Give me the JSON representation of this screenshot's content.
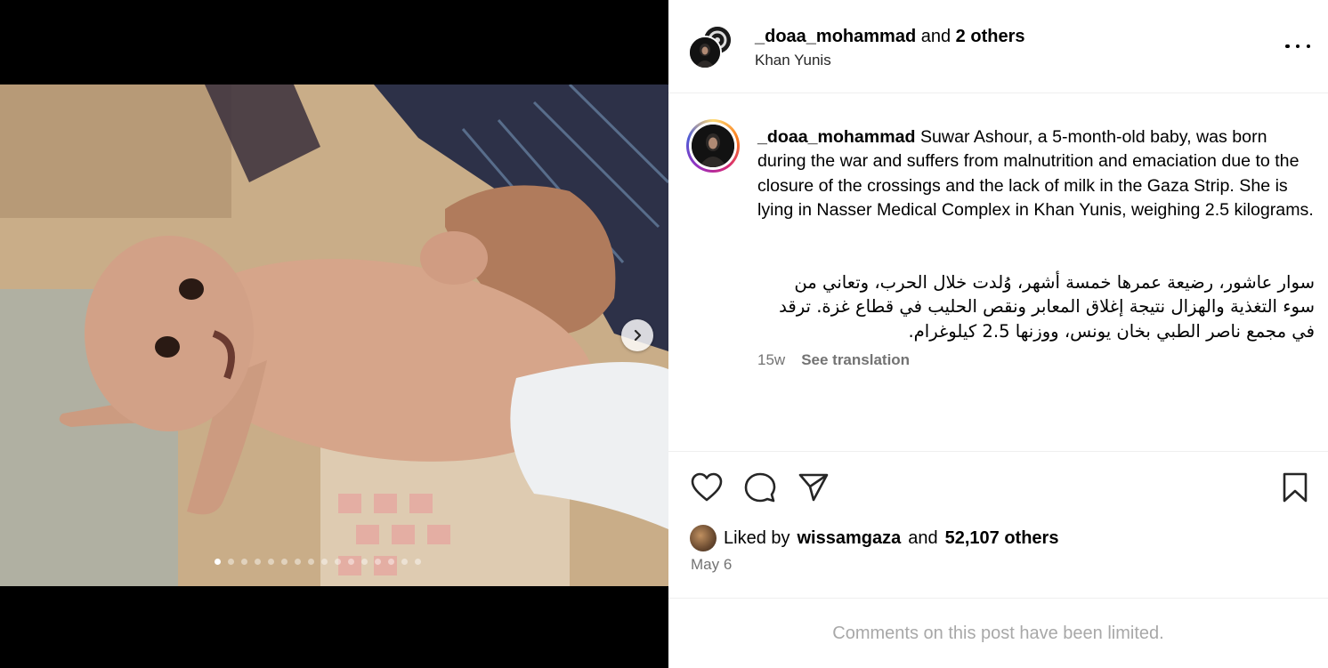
{
  "media": {
    "carousel": {
      "total": 16,
      "active": 0
    }
  },
  "post": {
    "header": {
      "author": "_doaa_mohammad",
      "and_text": "and",
      "others": "2 others",
      "location": "Khan Yunis"
    },
    "caption": {
      "username": "_doaa_mohammad",
      "text_en": "Suwar Ashour, a 5-month-old baby, was born during the war and suffers from malnutrition and emaciation due to the closure of the crossings and the lack of milk in the Gaza Strip. She is lying in Nasser Medical Complex in Khan Yunis, weighing 2.5 kilograms.",
      "text_ar": "سوار عاشور، رضيعة عمرها خمسة أشهر، وُلدت خلال الحرب، وتعاني من سوء التغذية والهزال نتيجة إغلاق المعابر ونقص الحليب في قطاع غزة. ترقد في مجمع ناصر الطبي بخان يونس، ووزنها 2.5 كيلوغرام.",
      "age": "15w",
      "see_translation": "See translation"
    },
    "likes": {
      "prefix": "Liked by",
      "user": "wissamgaza",
      "and_text": "and",
      "others": "52,107 others"
    },
    "date": "May 6",
    "comments_notice": "Comments on this post have been limited."
  },
  "icons": {
    "more": "more-horizontal-icon",
    "like": "heart-icon",
    "comment": "comment-icon",
    "share": "paper-plane-icon",
    "save": "bookmark-icon",
    "next": "chevron-right-icon"
  }
}
